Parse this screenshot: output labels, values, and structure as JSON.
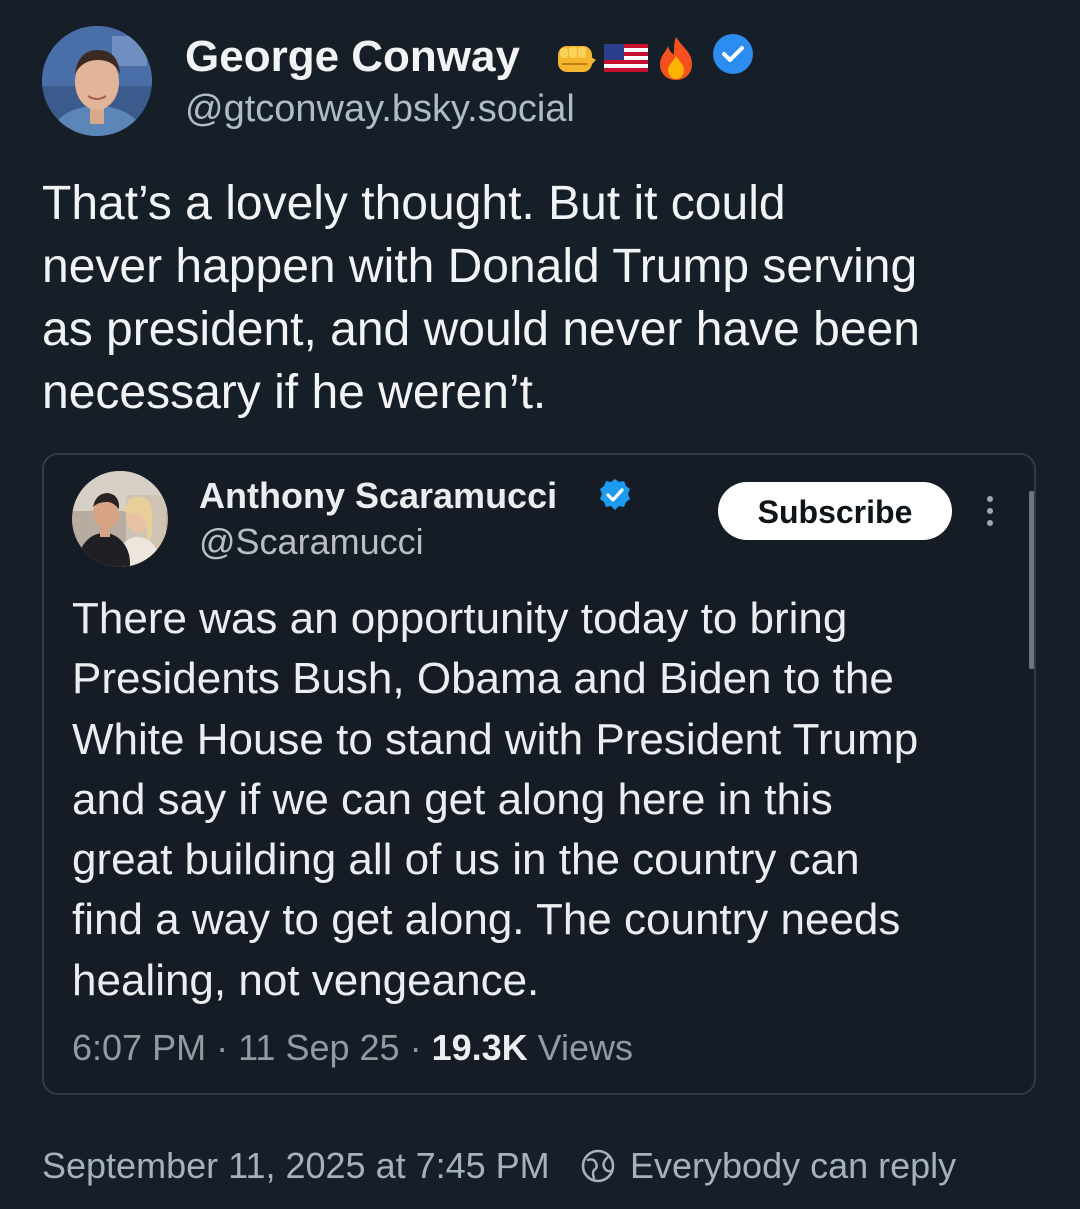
{
  "post": {
    "author": {
      "name": "George Conway",
      "handle": "@gtconway.bsky.social",
      "emojis": [
        "oncoming-fist-emoji",
        "us-flag-emoji",
        "fire-emoji"
      ],
      "verified": true
    },
    "text": "That’s a lovely thought.   But it could\nnever happen with Donald Trump serving\nas president, and would never have been\nnecessary if he weren’t.",
    "timestamp": "September 11, 2025 at 7:45 PM",
    "reply_setting": "Everybody can reply"
  },
  "quote": {
    "author": {
      "name": "Anthony Scaramucci",
      "handle": "@Scaramucci",
      "verified": true
    },
    "subscribe_label": "Subscribe",
    "text": "There was an opportunity today to bring\nPresidents Bush, Obama and Biden to the\nWhite House to stand with President Trump\nand say if we can get along here in this\ngreat building all of us in the country can\nfind a way to get along.  The country needs\nhealing, not vengeance.",
    "time": "6:07 PM",
    "date": "11 Sep 25",
    "views_count": "19.3K",
    "views_label": "Views"
  },
  "colors": {
    "background": "#161e27",
    "verified_blue": "#1d9bf0",
    "bsky_verified_blue": "#2d8cf0"
  }
}
